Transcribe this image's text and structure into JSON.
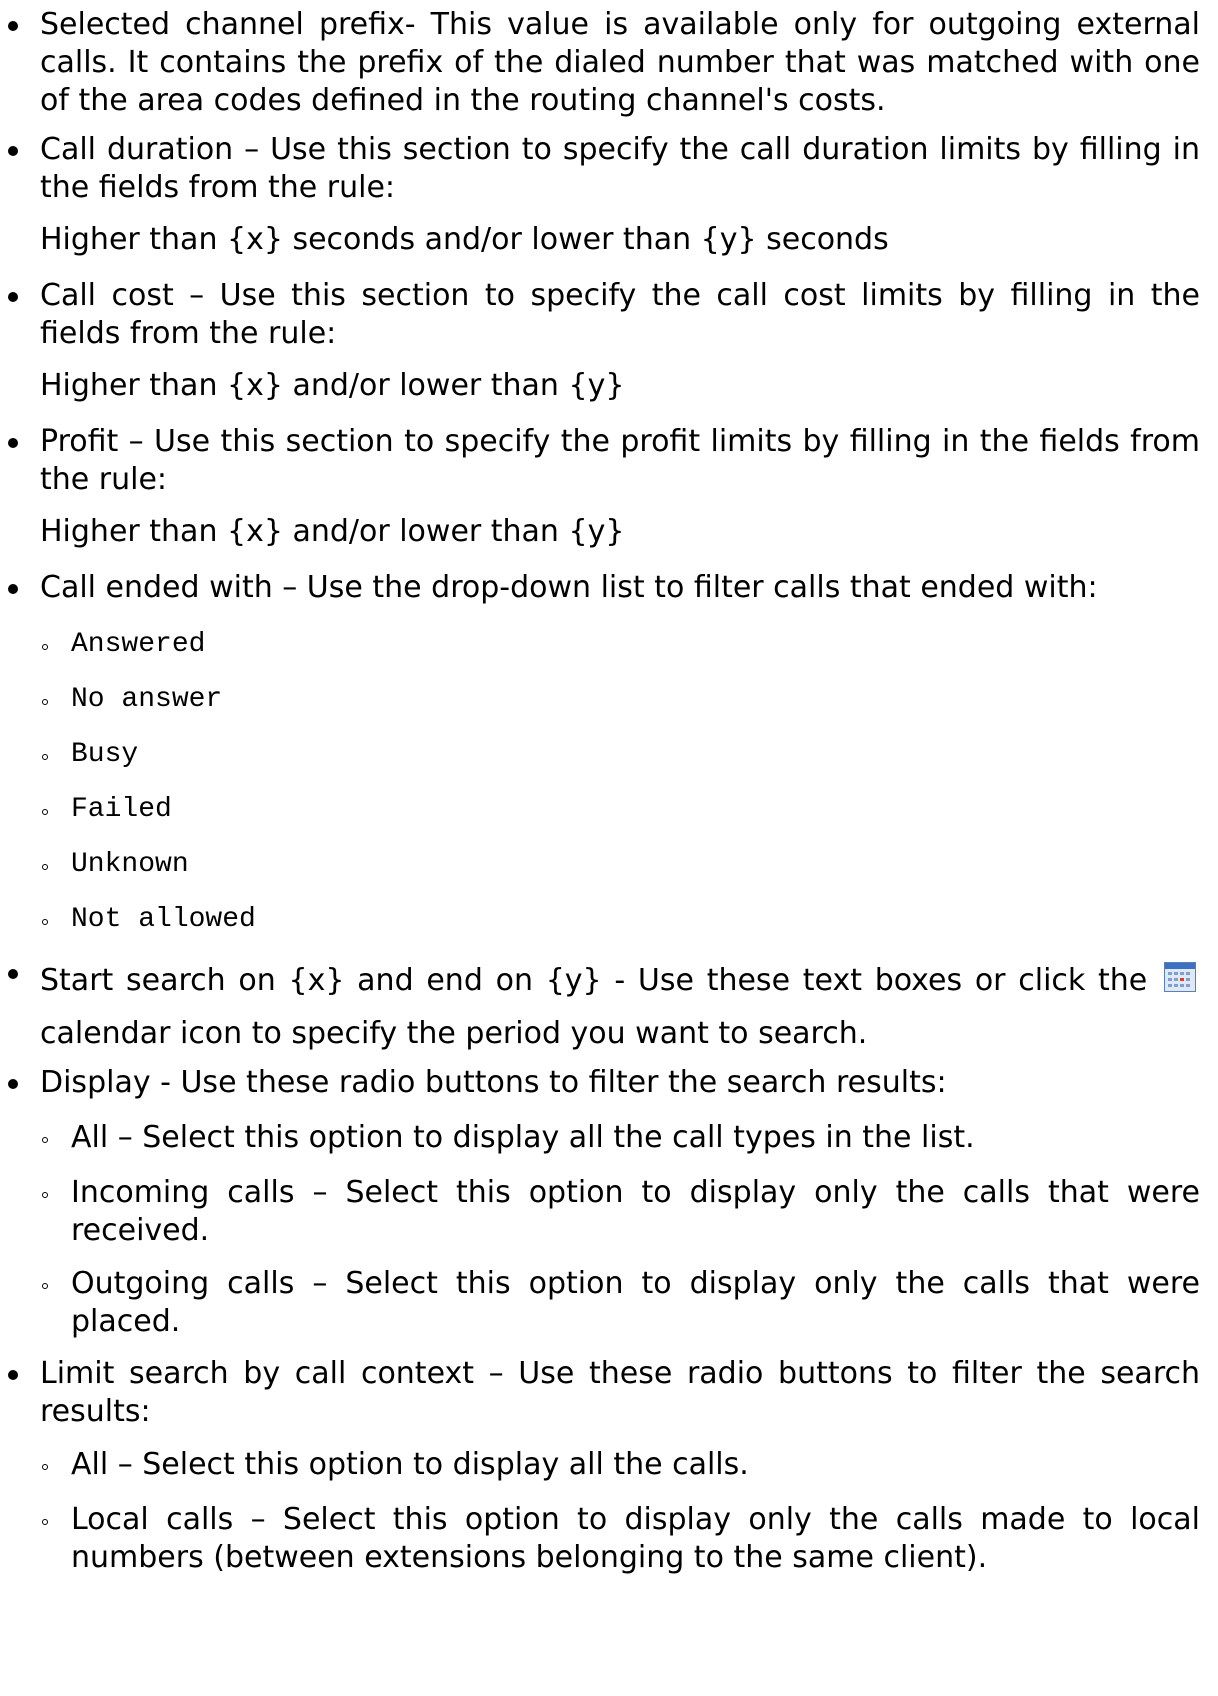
{
  "items": [
    {
      "label": "Selected channel prefix",
      "text": "Selected channel prefix- This value is available only for outgoing external calls. It contains the prefix of the dialed number that was matched with one of the area codes defined in the routing channel's costs."
    },
    {
      "text": "Call duration – Use this section to specify the call duration limits by filling in the fields from the rule:"
    },
    {
      "rule": "Higher than {x} seconds and/or lower than {y} seconds"
    },
    {
      "text": "Call cost – Use this section to specify the call cost limits by filling in the fields from the rule:"
    },
    {
      "rule": "Higher than {x} and/or lower than {y}"
    },
    {
      "text": "Profit – Use this section to specify the profit limits by filling in the fields from the rule:"
    },
    {
      "rule": "Higher than {x} and/or lower than {y}"
    },
    {
      "text": "Call ended with – Use the drop-down list to filter calls that ended with:"
    }
  ],
  "ended_options": [
    "Answered",
    "No answer",
    "Busy",
    "Failed",
    "Unknown",
    "Not allowed"
  ],
  "search": {
    "before": "Start search on {x} and end on {y} - Use these text boxes or click the",
    "after": "calendar icon to specify the period you want to search."
  },
  "display": {
    "text": "Display - Use these radio buttons to filter the search results:",
    "options": [
      "All – Select this option to display all the call types in the list.",
      "Incoming calls – Select this option to display only the calls that were received.",
      "Outgoing calls – Select this option to display only the calls that were placed."
    ]
  },
  "context": {
    "text": "Limit search by call context – Use these radio buttons to filter the search results:",
    "options": [
      "All – Select this option to display all the calls.",
      "Local calls – Select this option to display only the calls made to local numbers (between extensions belonging to the same client)."
    ]
  },
  "icons": {
    "calendar": "calendar-icon"
  }
}
